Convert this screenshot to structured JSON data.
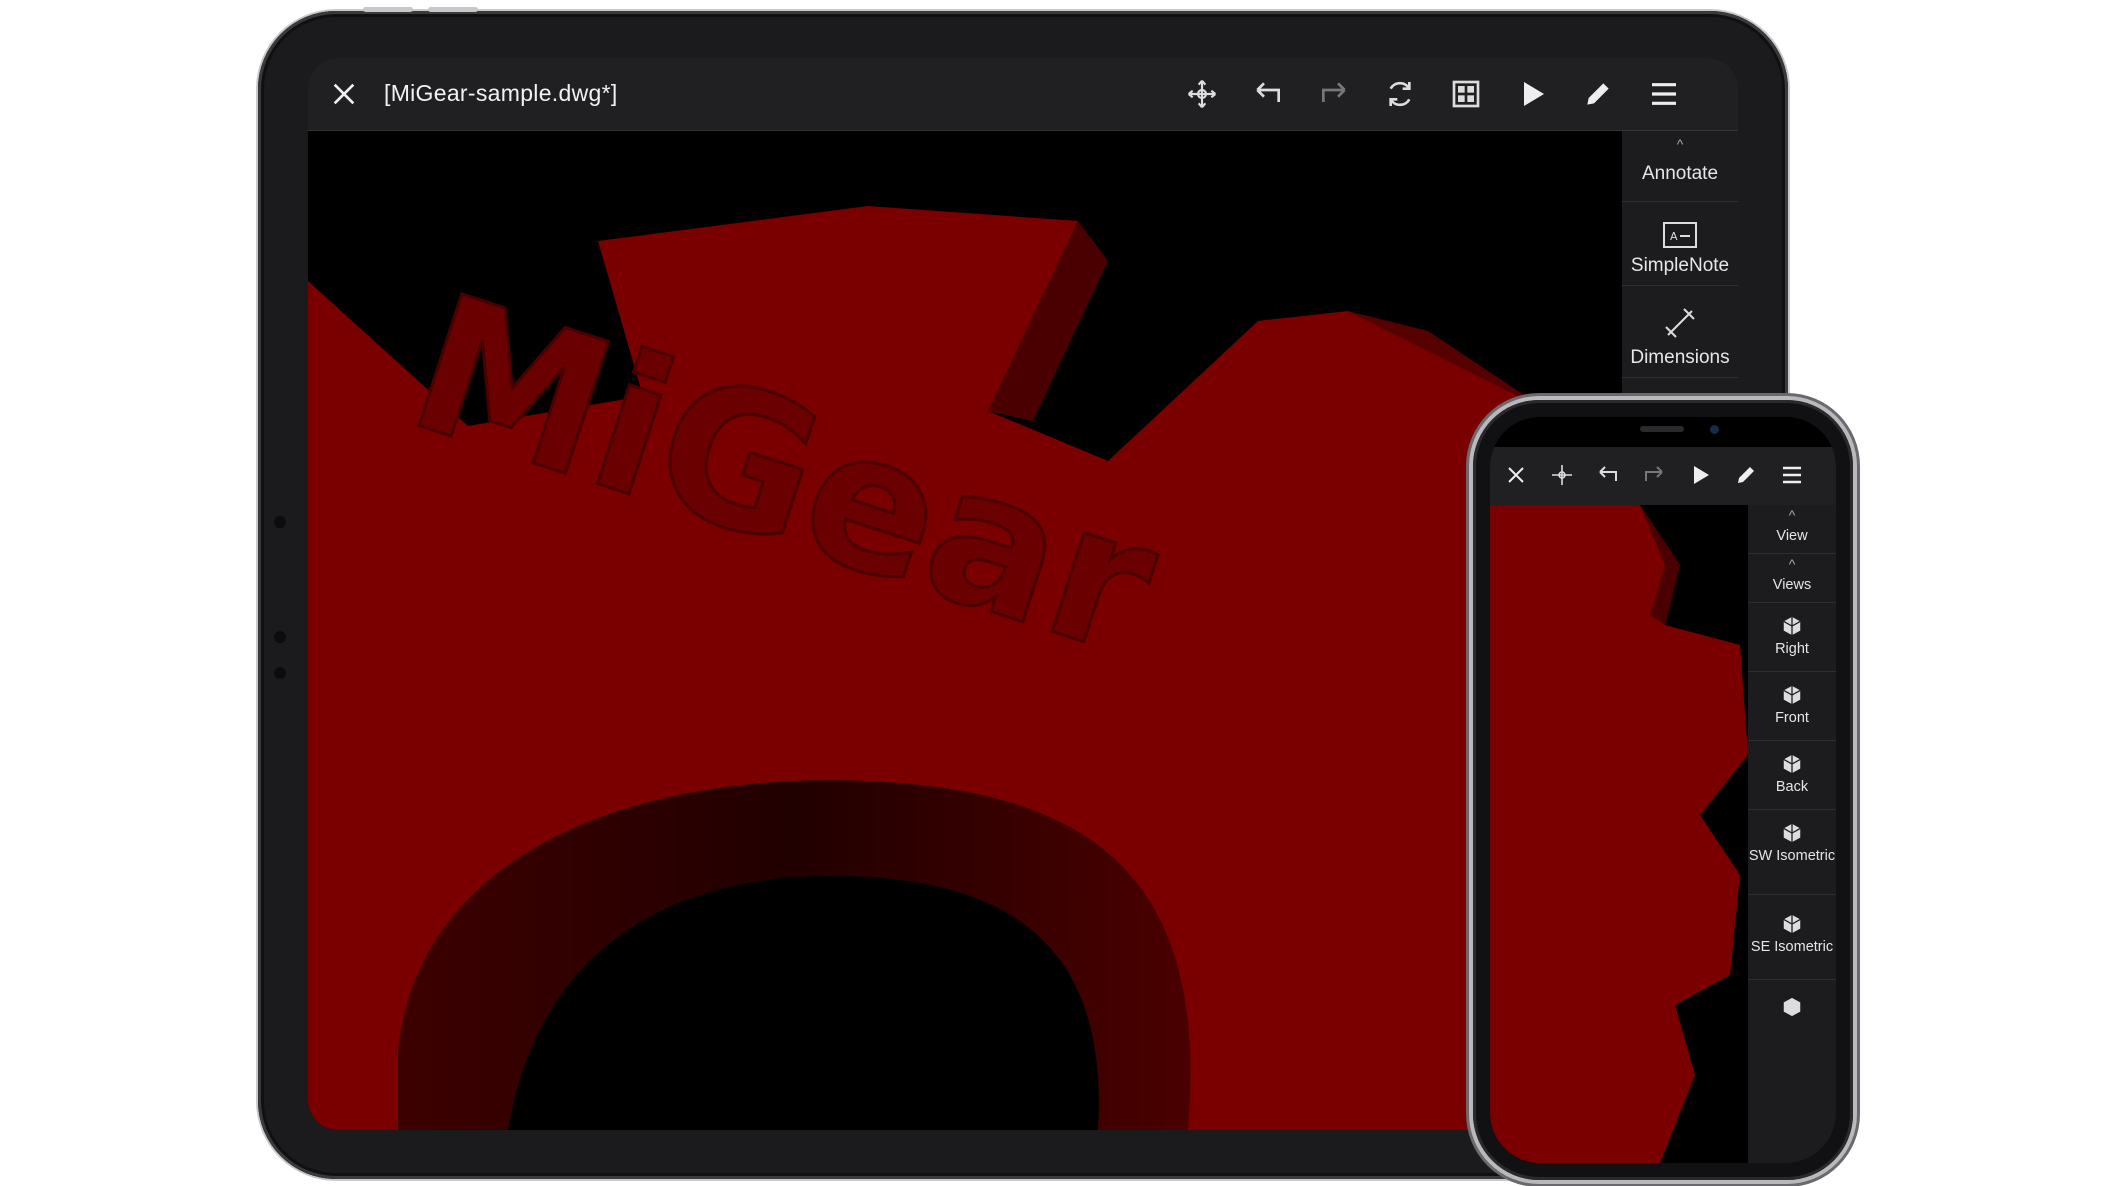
{
  "ipad": {
    "document_title": "[MiGear-sample.dwg*]",
    "toolbar_icons": [
      "close-icon",
      "pan-icon",
      "undo-icon",
      "redo-icon",
      "sync-icon",
      "grid-icon",
      "play-icon",
      "pencil-icon",
      "menu-icon"
    ],
    "side_panel": {
      "items": [
        {
          "label": "Annotate",
          "icon": "chevron-up-icon"
        },
        {
          "label": "SimpleNote",
          "icon": "note-icon"
        },
        {
          "label": "Dimensions",
          "icon": "dimension-icon"
        }
      ]
    }
  },
  "iphone": {
    "toolbar_icons": [
      "close-icon",
      "pan-icon",
      "undo-icon",
      "redo-icon",
      "play-icon",
      "pencil-icon",
      "menu-icon"
    ],
    "side_panel": {
      "items": [
        {
          "label": "View",
          "icon": "chevron-up-icon"
        },
        {
          "label": "Views",
          "icon": "chevron-up-icon"
        },
        {
          "label": "Right",
          "icon": "cube-icon"
        },
        {
          "label": "Front",
          "icon": "cube-icon"
        },
        {
          "label": "Back",
          "icon": "cube-icon"
        },
        {
          "label": "SW Isometric",
          "icon": "cube-icon"
        },
        {
          "label": "SE Isometric",
          "icon": "cube-icon"
        }
      ]
    }
  },
  "model": {
    "embossed_text": "MiGear",
    "color": "#7a0000",
    "background": "#000000"
  }
}
